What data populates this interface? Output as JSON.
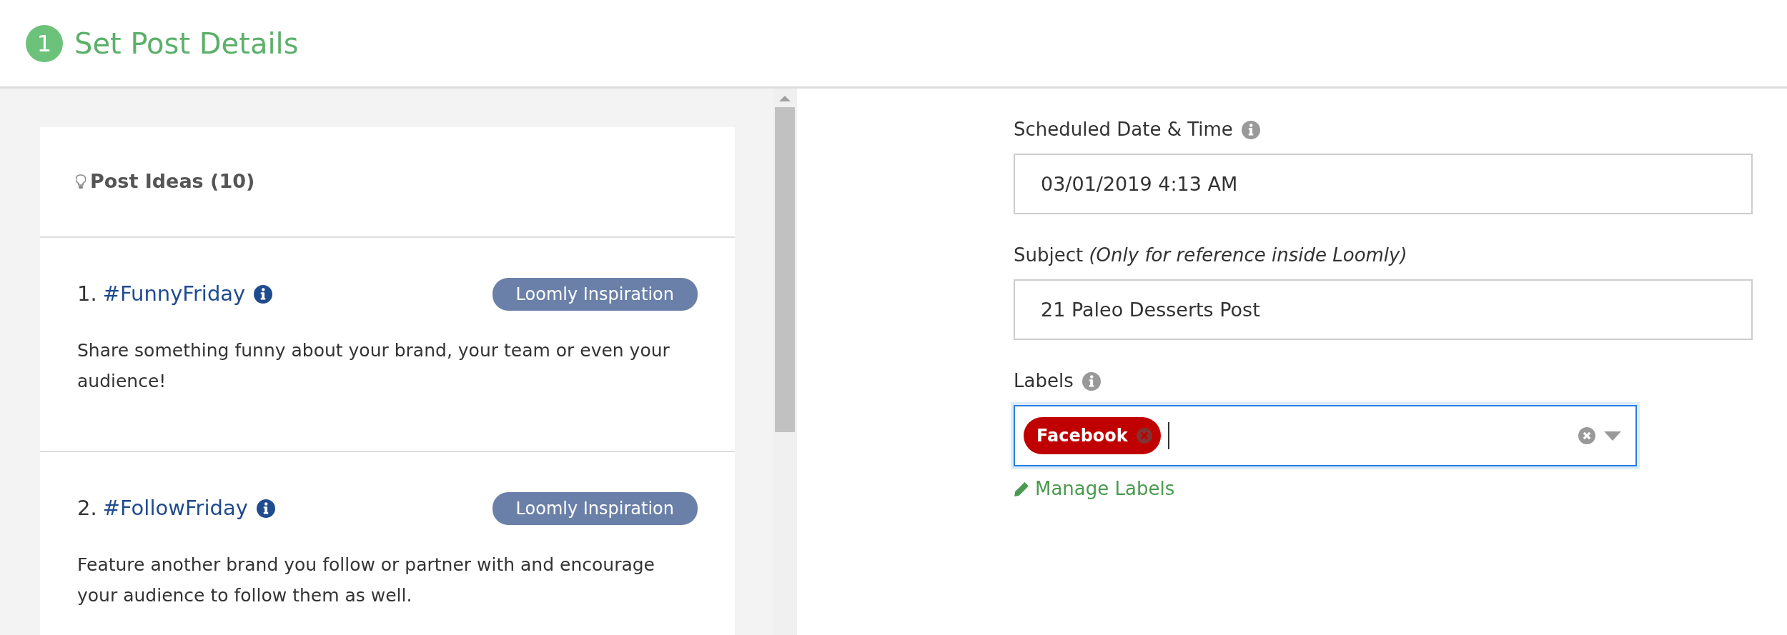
{
  "header": {
    "step": "1",
    "title": "Set Post Details"
  },
  "ideas": {
    "title": "Post Ideas (10)",
    "items": [
      {
        "number": "1.",
        "tag": "#FunnyFriday",
        "info": true,
        "badge": "Loomly Inspiration",
        "description": "Share something funny about your brand, your team or even your audience!"
      },
      {
        "number": "2.",
        "tag": "#FollowFriday",
        "info": true,
        "badge": "Loomly Inspiration",
        "description": "Feature another brand you follow or partner with and encourage your audience to follow them as well."
      }
    ]
  },
  "form": {
    "fields": [
      {
        "kind": "text",
        "label": "Scheduled Date & Time",
        "info": true,
        "value": "03/01/2019 4:13 AM"
      },
      {
        "kind": "text",
        "label": "Subject *(Only for reference inside Loomly)*",
        "info": false,
        "value": "21 Paleo Desserts Post"
      },
      {
        "kind": "tags",
        "label": "Labels",
        "info": true,
        "focused": true,
        "tags": [
          {
            "text": "Facebook",
            "color": "#c00000"
          }
        ]
      }
    ],
    "link": "Manage Labels"
  }
}
